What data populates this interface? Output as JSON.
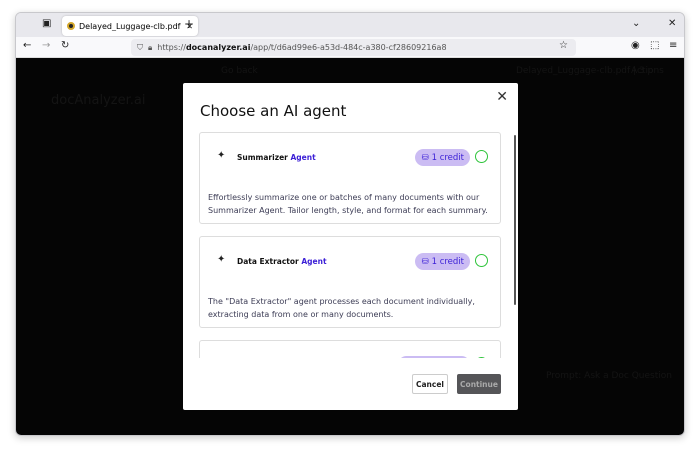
{
  "browser": {
    "tab_title": "Delayed_Luggage-clb.pdf",
    "url_prefix": "https://",
    "url_domain": "docanalyzer.ai",
    "url_path": "/app/t/d6ad99e6-a53d-484c-a380-cf28609216a8"
  },
  "background": {
    "logo": "docAnalyzer.ai",
    "back": "Go back",
    "file": "Delayed_Luggage-clb.pdf | 3 p",
    "actions": "Actions",
    "prompt": "Prompt: Ask a Doc Question"
  },
  "modal": {
    "title": "Choose an AI agent",
    "cancel": "Cancel",
    "continue": "Continue",
    "agents": [
      {
        "name": "Summarizer",
        "suffix": "Agent",
        "credit": "1 credit",
        "description": "Effortlessly summarize one or batches of many documents with our Summarizer Agent. Tailor length, style, and format for each summary."
      },
      {
        "name": "Data Extractor",
        "suffix": "Agent",
        "credit": "1 credit",
        "description": "The \"Data Extractor\" agent processes each document individually, extracting data from one or many documents."
      }
    ]
  }
}
